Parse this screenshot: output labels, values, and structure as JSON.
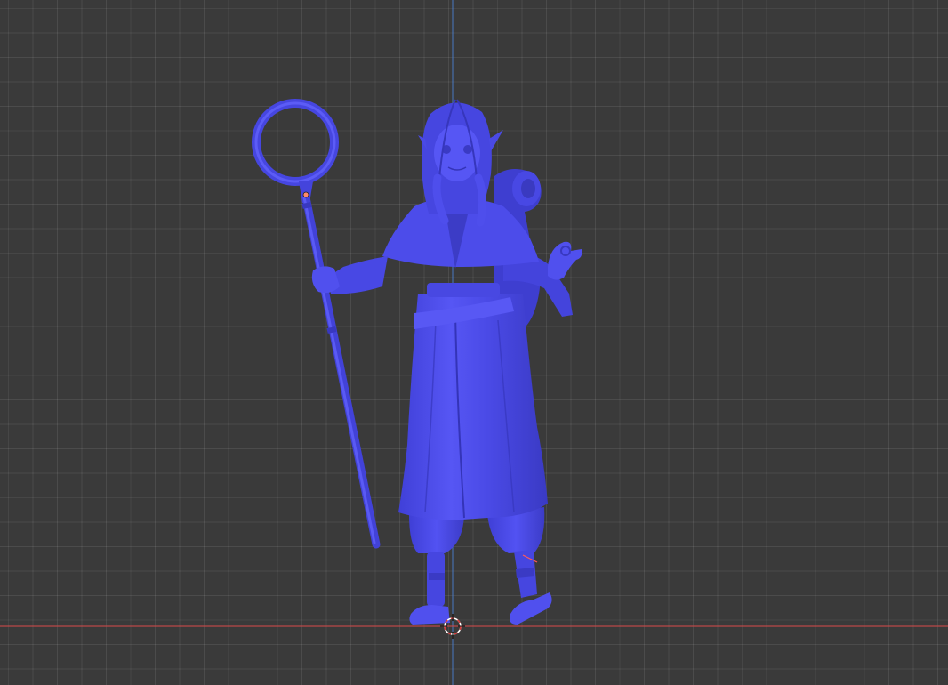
{
  "viewport": {
    "background": "#3a3a3a",
    "model_color": "#4a4af0",
    "x_axis_color": "#c84a4a",
    "z_axis_color": "#4a7fd0",
    "cursor": "3d-cursor-icon"
  }
}
